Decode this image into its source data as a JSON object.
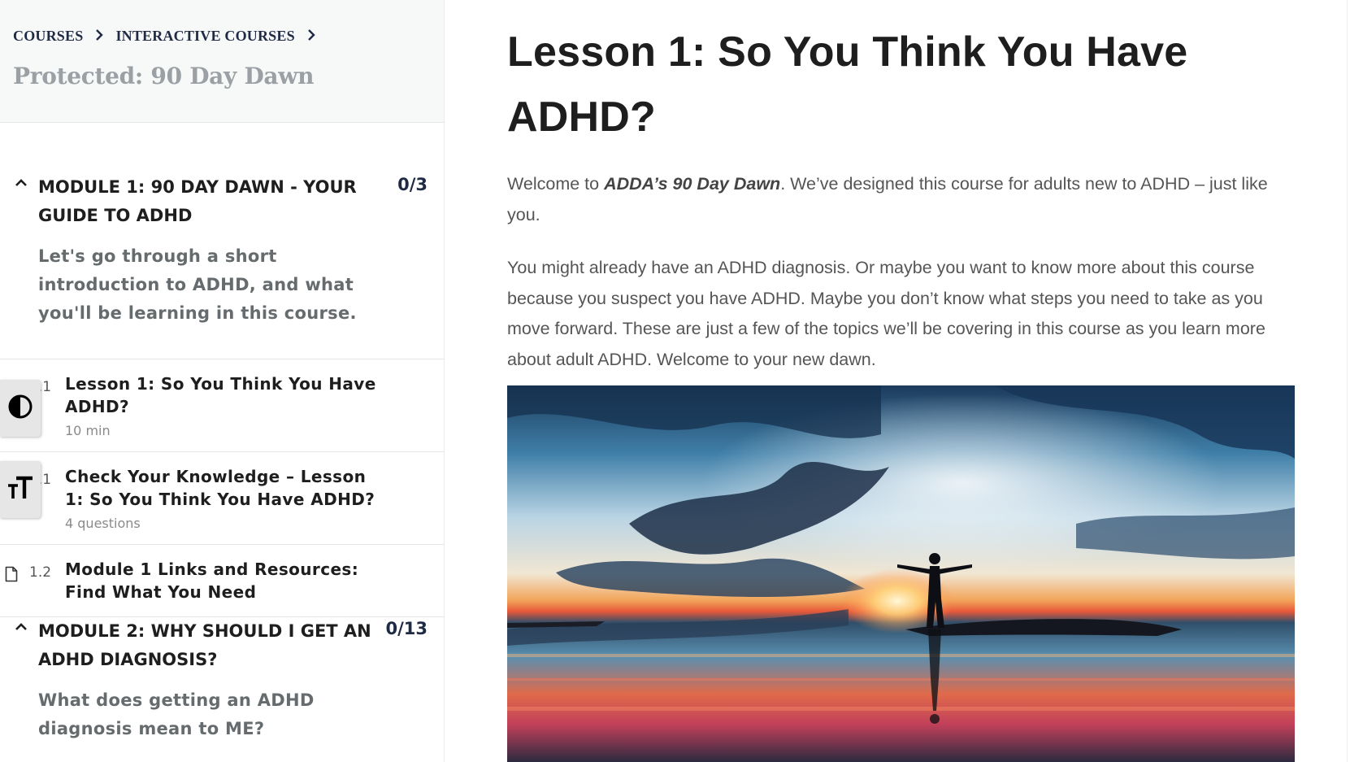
{
  "sidebar": {
    "breadcrumb": [
      {
        "label": "COURSES"
      },
      {
        "label": "INTERACTIVE COURSES"
      }
    ],
    "course_title": "Protected: 90 Day Dawn",
    "modules": [
      {
        "title": "MODULE 1: 90 DAY DAWN - YOUR GUIDE TO ADHD",
        "count": "0/3",
        "description": "Let's go through a short introduction to ADHD, and what you'll be learning in this course.",
        "lessons": [
          {
            "num": "1.1",
            "title": "Lesson 1: So You Think You Have ADHD?",
            "meta": "10 min"
          },
          {
            "num": "1.1",
            "title": "Check Your Knowledge – Lesson 1: So You Think You Have ADHD?",
            "meta": "4 questions"
          },
          {
            "num": "1.2",
            "title": "Module 1 Links and Resources: Find What You Need",
            "meta": ""
          }
        ]
      },
      {
        "title": "MODULE 2: WHY SHOULD I GET AN ADHD DIAGNOSIS?",
        "count": "0/13",
        "description": "What does getting an ADHD diagnosis mean to ME?"
      }
    ]
  },
  "a11y": {
    "contrast_icon": "contrast-icon",
    "text_size_icon": "text-size-icon"
  },
  "main": {
    "heading": "Lesson 1: So You Think You Have ADHD?",
    "intro_before": "Welcome to ",
    "intro_emph": "ADDA’s 90 Day Dawn",
    "intro_after": ". We’ve designed this course for adults new to ADHD – just like you.",
    "paragraph2": "You might already have an ADHD diagnosis. Or maybe you want to know more about this course because you suspect you have ADHD. Maybe you don’t know what steps you need to take as you move forward. These are just a few of the topics we’ll be covering in this course as you learn more about adult ADHD. Welcome to your new dawn.",
    "hero_image": "sunrise-silhouette-image"
  },
  "colors": {
    "breadcrumb": "#1f2a44",
    "course_title": "#9aa0a3",
    "module_count": "#1f2a44",
    "header_bg": "#f7f8f8"
  }
}
